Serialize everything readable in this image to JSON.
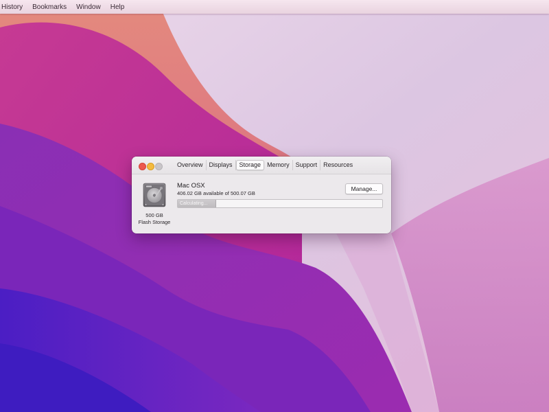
{
  "menubar": {
    "items": [
      "History",
      "Bookmarks",
      "Window",
      "Help"
    ]
  },
  "window": {
    "tabs": [
      "Overview",
      "Displays",
      "Storage",
      "Memory",
      "Support",
      "Resources"
    ],
    "selected_tab": "Storage",
    "drive": {
      "icon": "hard-drive-icon",
      "size_label": "500 GB",
      "type_label": "Flash Storage"
    },
    "volume": {
      "name": "Mac OSX",
      "availability": "406.02 GB available of 500.07 GB"
    },
    "manage_label": "Manage...",
    "storage_bar": {
      "label": "Calculating..."
    }
  },
  "colors": {
    "close": "#ed5a4f",
    "minimize": "#f4bb3f",
    "zoom_disabled": "#c9c6c9"
  }
}
